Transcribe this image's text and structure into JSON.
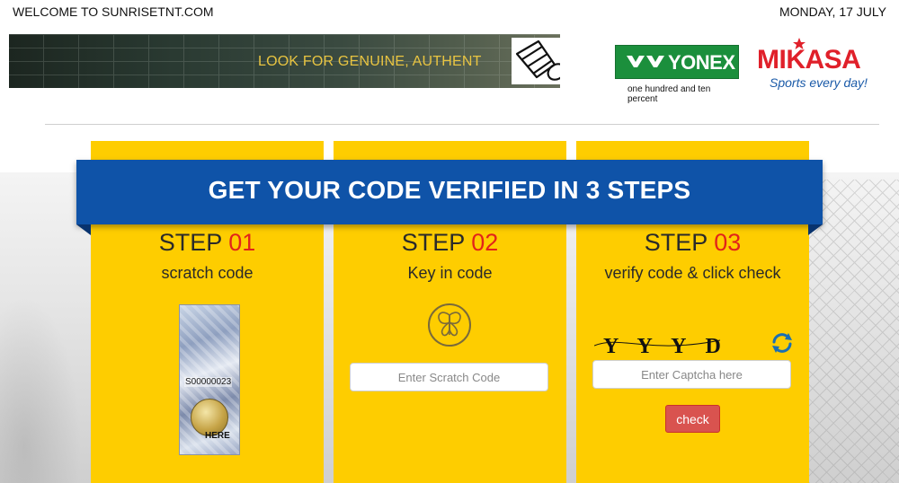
{
  "header": {
    "welcome": "WELCOME TO SUNRISETNT.COM",
    "date": "MONDAY, 17 JULY"
  },
  "banner": {
    "text": "LOOK FOR GENUINE, AUTHENT",
    "icon": "shuttlecock-icon"
  },
  "brands": {
    "yonex": {
      "name": "YONEX",
      "tagline": "one hundred and ten percent",
      "color": "#1b8f3c"
    },
    "mikasa": {
      "name": "MIKASA",
      "tagline": "Sports every day!",
      "color": "#e0202a",
      "tag_color": "#1a5aa8"
    }
  },
  "ribbon": {
    "title": "GET YOUR CODE VERIFIED IN 3 STEPS",
    "color": "#0f53a8"
  },
  "steps": [
    {
      "label": "STEP",
      "number": "01",
      "description": "scratch code",
      "scratch_serial": "S00000023",
      "scratch_hint": "HERE"
    },
    {
      "label": "STEP",
      "number": "02",
      "description": "Key in code",
      "input_placeholder": "Enter Scratch Code",
      "icon": "butterfly-key-icon"
    },
    {
      "label": "STEP",
      "number": "03",
      "description": "verify code & click check",
      "captcha_text": "Y Y Y D",
      "input_placeholder": "Enter Captcha here",
      "button_label": "check",
      "icon": "refresh-icon"
    }
  ],
  "colors": {
    "card": "#fecd00",
    "accent_red": "#e2231a",
    "button": "#d9534f"
  }
}
